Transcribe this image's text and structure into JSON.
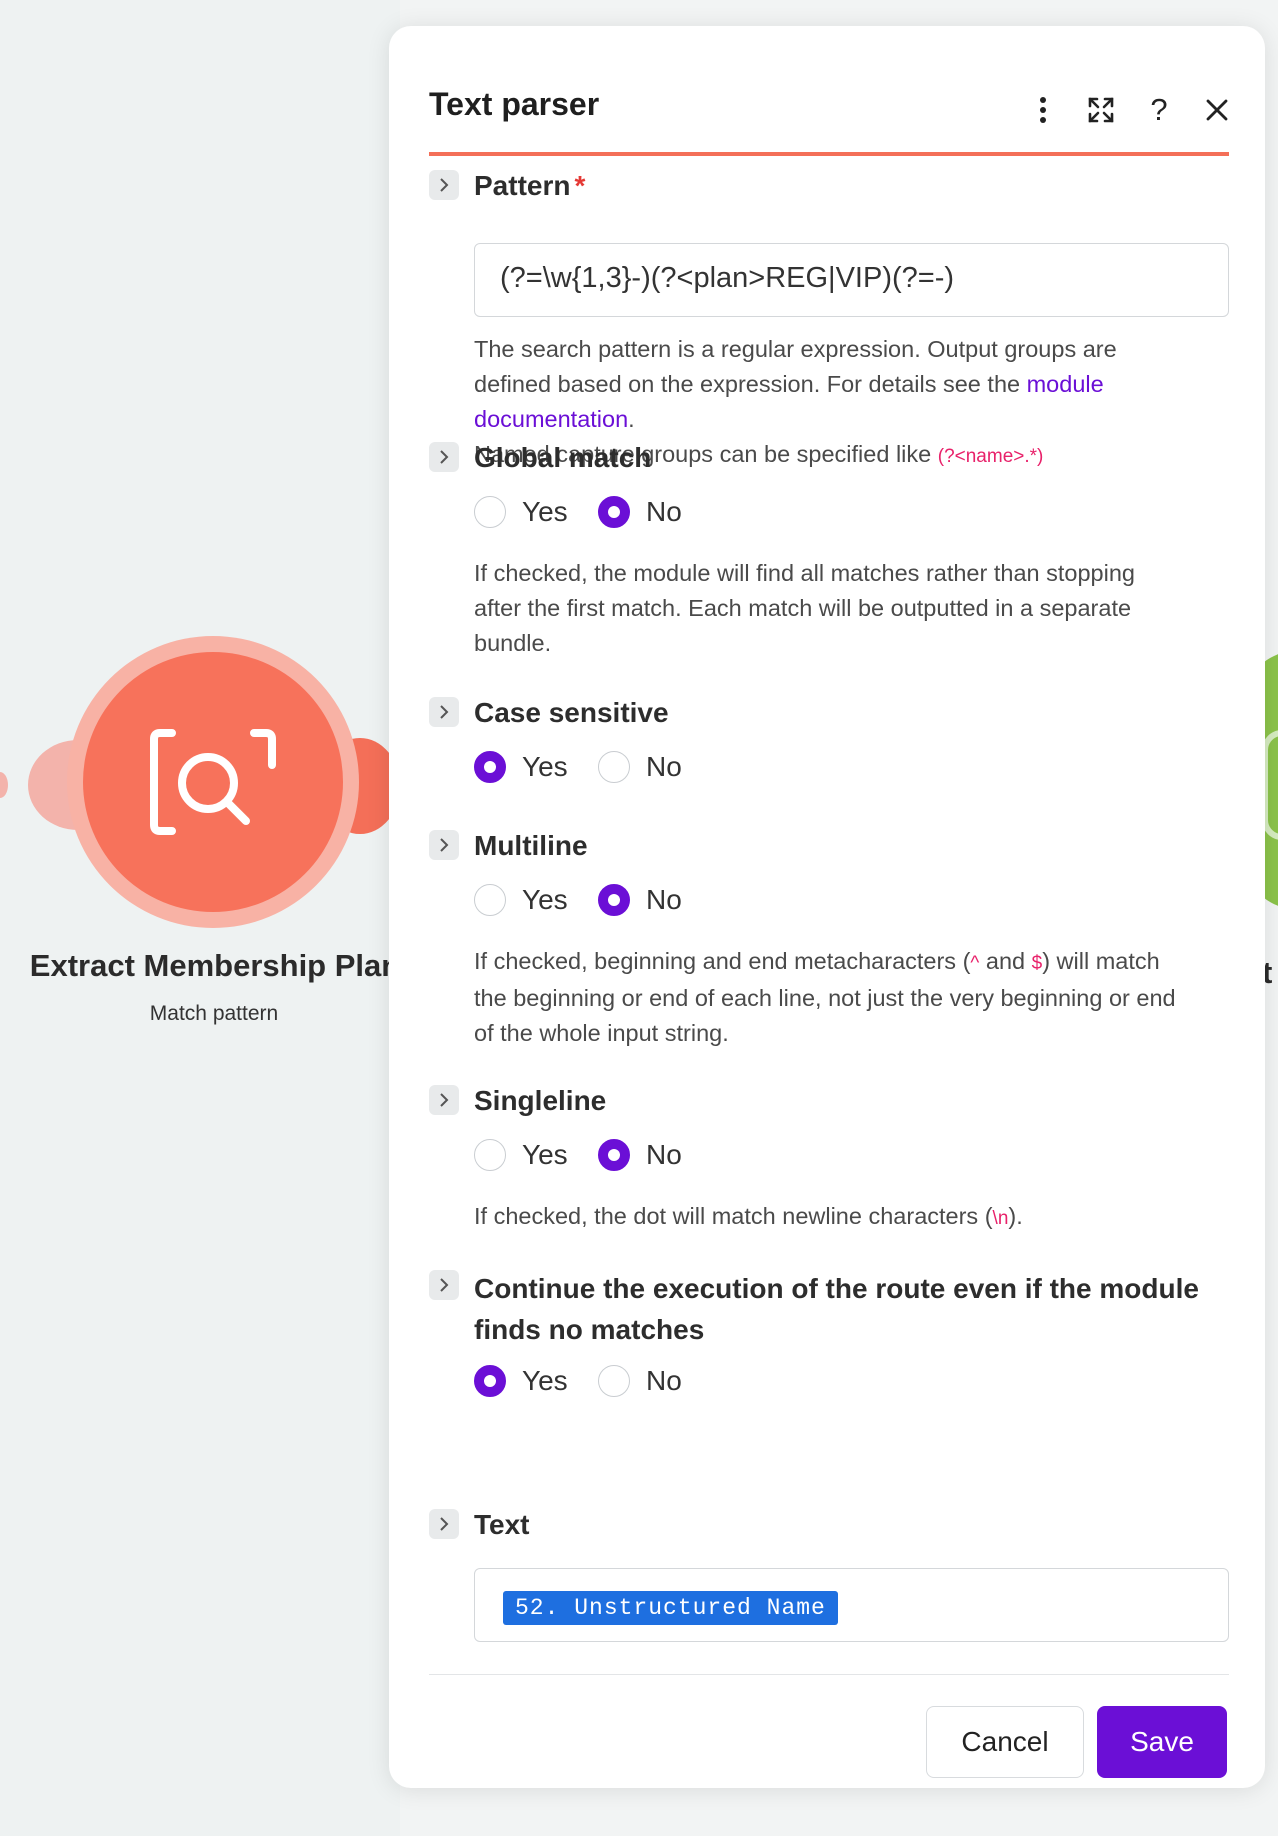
{
  "colors": {
    "accent": "#6b0fd6",
    "module_brand": "#f7725b",
    "header_underline": "#f46f58",
    "pill": "#1e6fe0",
    "code_highlight": "#e8216a",
    "required": "#e53935"
  },
  "canvas": {
    "module": {
      "title": "Extract Membership Plan",
      "subtitle": "Match pattern",
      "icon": "text-parser-search-icon"
    },
    "next_module": {
      "label_fragment": "t"
    }
  },
  "dialog": {
    "title": "Text parser",
    "header_buttons": [
      {
        "name": "more-options",
        "icon": "vertical-dots-icon"
      },
      {
        "name": "expand",
        "icon": "expand-arrows-icon"
      },
      {
        "name": "help",
        "icon": "question-mark-icon",
        "glyph": "?"
      },
      {
        "name": "close",
        "icon": "close-icon"
      }
    ],
    "pattern": {
      "label": "Pattern",
      "required_mark": "*",
      "value": "(?=\\w{1,3}-)(?<plan>REG|VIP)(?=-)",
      "help_line1": "The search pattern is a regular expression. Output groups are",
      "help_line2_pre": "defined based on the expression. For details see the ",
      "help_link_1": "module",
      "help_link_2": "documentation",
      "help_line3_post": ".",
      "help_line4": "Named capture groups can be specified like ",
      "help_code": "(?<name>.*)"
    },
    "global_match": {
      "label": "Global match",
      "yes": "Yes",
      "no": "No",
      "selected": "No",
      "help": [
        "If checked, the module will find all matches rather than stopping",
        "after the first match. Each match will be outputted in a separate",
        "bundle."
      ]
    },
    "case_sensitive": {
      "label": "Case sensitive",
      "yes": "Yes",
      "no": "No",
      "selected": "Yes"
    },
    "multiline": {
      "label": "Multiline",
      "yes": "Yes",
      "no": "No",
      "selected": "No",
      "help_pre": "If checked, beginning and end metacharacters (",
      "help_code1": "^",
      "help_mid": " and ",
      "help_code2": "$",
      "help_post": ") will match",
      "help_line2": "the beginning or end of each line, not just the very beginning or end",
      "help_line3": "of the whole input string."
    },
    "singleline": {
      "label": "Singleline",
      "yes": "Yes",
      "no": "No",
      "selected": "No",
      "help_pre": "If checked, the dot will match newline characters (",
      "help_code": "\\n",
      "help_post": ")."
    },
    "continue_execution": {
      "label_line1": "Continue the execution of the route even if the module",
      "label_line2": "finds no matches",
      "yes": "Yes",
      "no": "No",
      "selected": "Yes"
    },
    "text": {
      "label": "Text",
      "pill": "52. Unstructured Name"
    },
    "footer": {
      "cancel": "Cancel",
      "save": "Save"
    }
  }
}
